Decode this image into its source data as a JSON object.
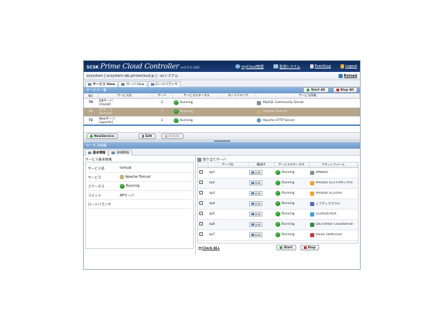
{
  "header": {
    "brand_prefix": "SCSK",
    "brand_name": "Prime Cloud Controller",
    "version": "ver2.0.0-1881",
    "links": [
      {
        "label": "myCloud管理",
        "icon": "cloud-icon",
        "color": "#7fb2e5"
      },
      {
        "label": "監視システム",
        "icon": "monitor-icon",
        "color": "#9cc2e0"
      },
      {
        "label": "EventLog",
        "icon": "eventlog-icon",
        "color": "#d8d8d8"
      },
      {
        "label": "Logout",
        "icon": "lock-icon",
        "color": "#e2b33b"
      }
    ]
  },
  "subheader": {
    "system_label": "ecsystem [ ecsystem.lab.primecloud.jp ] - ecシステム",
    "reload_label": "Reload"
  },
  "view_tabs": [
    {
      "label": "サービス View",
      "active": true
    },
    {
      "label": "サーバ View",
      "active": false
    },
    {
      "label": "ロードバランサ",
      "active": false
    }
  ],
  "service_list": {
    "title": "サービス一覧",
    "start_all": "Start All",
    "stop_all": "Stop All",
    "columns": [
      "NO",
      "サービス名",
      "サーバ",
      "サービスステータス",
      "ロードバランサ",
      "サービス詳細"
    ],
    "rows": [
      {
        "no": "70",
        "name": "DBサーバ",
        "sub": "[mysql]",
        "servers": "2",
        "status": "Running",
        "lb": "",
        "detail": "MySQL Community Server",
        "icon": "db-icon"
      },
      {
        "no": "71",
        "name": "APサーバ",
        "sub": "[tomcat]",
        "servers": "7",
        "status": "Running",
        "lb": "",
        "detail": "Apache Tomcat",
        "icon": "tomcat-icon"
      },
      {
        "no": "72",
        "name": "Webサーバ",
        "sub": "[apache]",
        "servers": "2",
        "status": "Running",
        "lb": "",
        "detail": "Apache HTTP Server",
        "icon": "apache-icon"
      }
    ],
    "new_service": "NewService",
    "edit": "Edit",
    "delete": "Delete"
  },
  "service_info": {
    "title": "サービス情報",
    "tabs": [
      "基本情報",
      "詳細情報"
    ],
    "basic_title": "サービス基本情報",
    "fields": [
      {
        "key": "サービス名",
        "value": "tomcat"
      },
      {
        "key": "サービス",
        "value": "Apache Tomcat"
      },
      {
        "key": "ステータス",
        "value": "Running"
      },
      {
        "key": "コメント",
        "value": "APサーバ"
      },
      {
        "key": "ロードバランサ",
        "value": ""
      }
    ],
    "assigned_title": "割り当てサーバ",
    "assigned_columns": [
      "",
      "サーバ名",
      "構成UI",
      "サービスステータス",
      "プラットフォーム"
    ],
    "servers": [
      {
        "name": "ap1",
        "link": "Link",
        "status": "Running",
        "platform": "VMware",
        "pf_color": "#8a8f96"
      },
      {
        "name": "ap2",
        "link": "Link",
        "status": "Running",
        "platform": "Amazon EC2+VPC(TYO)",
        "pf_color": "#f0a030"
      },
      {
        "name": "ap3",
        "link": "Link",
        "status": "Running",
        "platform": "Amazon EC2(US)",
        "pf_color": "#f0a030"
      },
      {
        "name": "ap4",
        "link": "Link",
        "status": "Running",
        "platform": "ニフティクラウド",
        "pf_color": "#5c6bbf"
      },
      {
        "name": "ap5",
        "link": "Link",
        "status": "Running",
        "platform": "CLOUDSTACK",
        "pf_color": "#3ea0d8"
      },
      {
        "name": "ap6",
        "link": "Link",
        "status": "Running",
        "platform": "IDCFrontier CloudServer",
        "pf_color": "#2f8a4a"
      },
      {
        "name": "ap7",
        "link": "Link",
        "status": "Running",
        "platform": "USIZE netXCloud",
        "pf_color": "#c23b3b"
      }
    ],
    "check_all": "Check ALL",
    "start": "Start",
    "stop": "Stop"
  },
  "colors": {
    "header_bg": "#0d2a58",
    "section_bar": "#7aa5d4",
    "selected_row": "#b7a58a",
    "running_green": "#2d9e2d",
    "start_green": "#2d9e2d",
    "stop_red": "#d03030"
  }
}
